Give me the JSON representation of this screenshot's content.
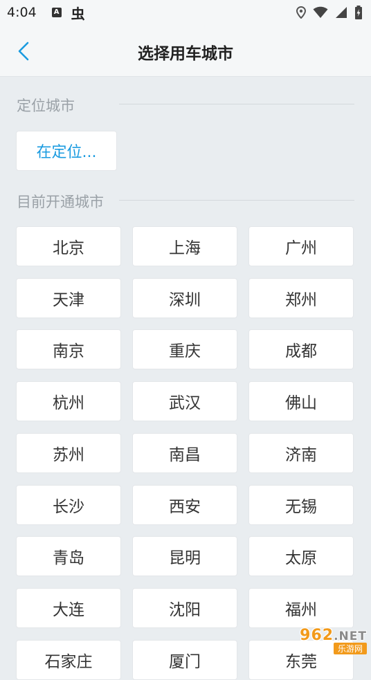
{
  "status_bar": {
    "time": "4:04",
    "notif_a": "A",
    "notif_bug": "虫"
  },
  "header": {
    "title": "选择用车城市"
  },
  "location_section": {
    "label": "定位城市",
    "locate_button": "在定位..."
  },
  "cities_section": {
    "label": "目前开通城市",
    "cities": [
      "北京",
      "上海",
      "广州",
      "天津",
      "深圳",
      "郑州",
      "南京",
      "重庆",
      "成都",
      "杭州",
      "武汉",
      "佛山",
      "苏州",
      "南昌",
      "济南",
      "长沙",
      "西安",
      "无锡",
      "青岛",
      "昆明",
      "太原",
      "大连",
      "沈阳",
      "福州",
      "石家庄",
      "厦门",
      "东莞"
    ]
  },
  "watermark": {
    "logo_number": "962",
    "logo_suffix": ".NET",
    "site_name": "乐游网"
  },
  "colors": {
    "accent": "#1a9be0",
    "background": "#e9edf0",
    "header_bg": "#f5f7f8",
    "watermark": "#f29a1b"
  }
}
